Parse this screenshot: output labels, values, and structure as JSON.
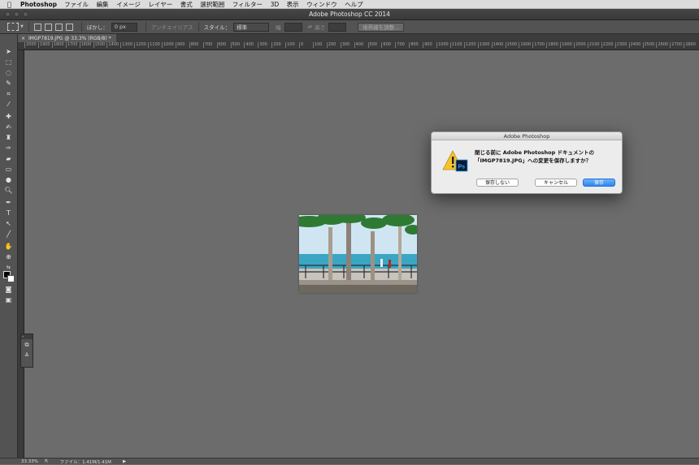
{
  "menubar": {
    "app_name": "Photoshop",
    "items": [
      "ファイル",
      "編集",
      "イメージ",
      "レイヤー",
      "書式",
      "選択範囲",
      "フィルター",
      "3D",
      "表示",
      "ウィンドウ",
      "ヘルプ"
    ]
  },
  "window": {
    "title": "Adobe Photoshop CC 2014"
  },
  "options_bar": {
    "feather_label": "ぼかし：",
    "feather_value": "0 px",
    "antialias_label": "アンチエイリアス",
    "style_label": "スタイル：",
    "style_value": "標準",
    "width_label": "幅",
    "height_label": "高さ",
    "refine_edge_button": "境界線を調整..."
  },
  "document_tab": {
    "title": "IMGP7819.JPG @ 33.3% (RGB/8) *"
  },
  "ruler": {
    "ticks": [
      "2000",
      "1900",
      "1800",
      "1700",
      "1600",
      "1500",
      "1400",
      "1300",
      "1200",
      "1100",
      "1000",
      "900",
      "800",
      "700",
      "600",
      "500",
      "400",
      "300",
      "200",
      "100",
      "0",
      "100",
      "200",
      "300",
      "400",
      "500",
      "600",
      "700",
      "800",
      "900",
      "1000",
      "1100",
      "1200",
      "1300",
      "1400",
      "1500",
      "1600",
      "1700",
      "1800",
      "1900",
      "2000",
      "2100",
      "2200",
      "2300",
      "2400",
      "2500",
      "2600",
      "2700",
      "2800"
    ]
  },
  "status_bar": {
    "zoom": "33.33%",
    "file_info": "ファイル：1.41M/1.41M"
  },
  "dialog": {
    "title": "Adobe Photoshop",
    "message_line1": "閉じる前に Adobe Photoshop ドキュメントの",
    "message_line2": "「IMGP7819.JPG」への変更を保存しますか？",
    "dont_save_button": "保存しない",
    "cancel_button": "キャンセル",
    "save_button": "保存",
    "app_badge": "Ps"
  },
  "colors": {
    "accent": "#2d86f2",
    "canvas": "#6c6c6c",
    "ui_dark": "#535353"
  }
}
